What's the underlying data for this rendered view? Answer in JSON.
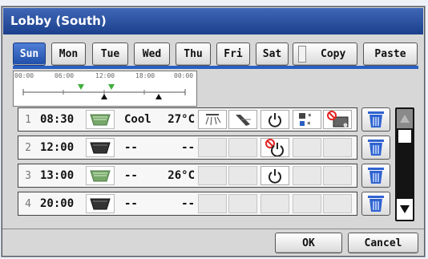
{
  "title": "Lobby (South)",
  "days": [
    "Sun",
    "Mon",
    "Tue",
    "Wed",
    "Thu",
    "Fri",
    "Sat"
  ],
  "selected_day": "Sun",
  "copy_label": "Copy",
  "paste_label": "Paste",
  "timeline": {
    "ticks": [
      "00:00",
      "06:00",
      "12:00",
      "18:00",
      "00:00"
    ],
    "events": [
      {
        "time": "08:30",
        "marker": "green-triangle-down"
      },
      {
        "time": "12:00",
        "marker": "black-triangle-up"
      },
      {
        "time": "13:00",
        "marker": "green-triangle-down"
      },
      {
        "time": "20:00",
        "marker": "black-triangle-up"
      }
    ]
  },
  "rows": [
    {
      "num": "1",
      "time": "08:30",
      "fan": "unit-on-icon",
      "mode": "Cool",
      "temp": "27°C",
      "vane": "airflow-direction-icon",
      "louver": "louver-icon",
      "power": "power-icon",
      "modes_icon": "mode-lock-icon",
      "prohibit_icon": "remote-prohibit-icon"
    },
    {
      "num": "2",
      "time": "12:00",
      "fan": "unit-off-icon",
      "mode": "--",
      "temp": "--",
      "power": "power-prohibited-icon"
    },
    {
      "num": "3",
      "time": "13:00",
      "fan": "unit-on-icon",
      "mode": "--",
      "temp": "26°C",
      "power": "power-icon"
    },
    {
      "num": "4",
      "time": "20:00",
      "fan": "unit-off-icon",
      "mode": "--",
      "temp": "--"
    }
  ],
  "ok_label": "OK",
  "cancel_label": "Cancel",
  "colors": {
    "title_bar": "#1b3f8c",
    "selected_tab": "#2a5fc1",
    "trash": "#2f63d0",
    "green_marker": "#3fae3a"
  }
}
